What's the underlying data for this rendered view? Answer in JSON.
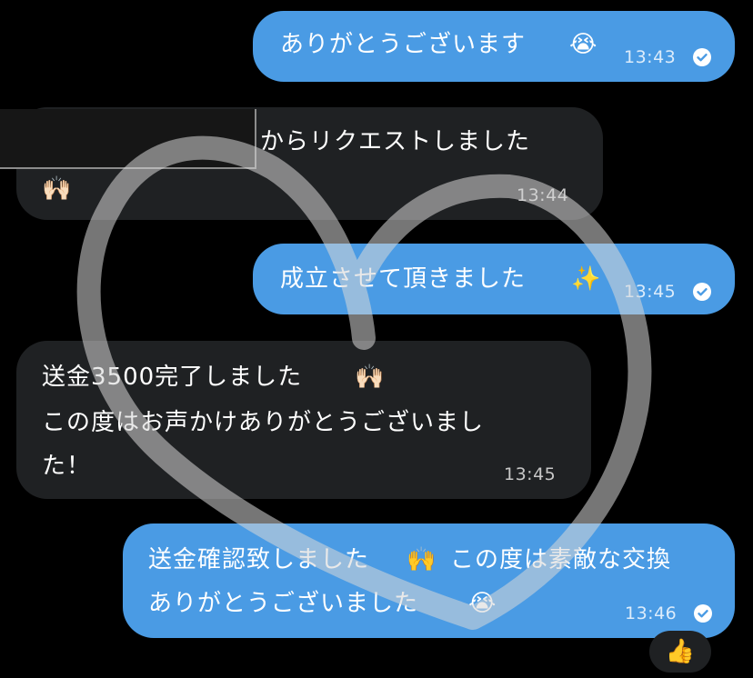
{
  "messages": [
    {
      "text": "ありがとうございます",
      "emoji": "😭",
      "time": "13:43"
    },
    {
      "text": "からリクエストしました",
      "emoji": "🙌🏻",
      "time": "13:44"
    },
    {
      "text": "成立させて頂きました",
      "emoji": "✨",
      "time": "13:45"
    },
    {
      "line1": "送金3500完了しました",
      "emoji": "🙌🏻",
      "line2": "この度はお声かけありがとうございまし",
      "line3": "た！",
      "time": "13:45"
    },
    {
      "line1a": "送金確認致しました",
      "emoji1": "🙌",
      "line1b": "この度は素敵な交換",
      "line2": "ありがとうございました",
      "emoji2": "😭",
      "time": "13:46"
    }
  ],
  "reaction": {
    "emoji": "👍"
  },
  "colors": {
    "outgoing": "#4a9be4",
    "incoming": "#1f2123",
    "background": "#000000"
  }
}
